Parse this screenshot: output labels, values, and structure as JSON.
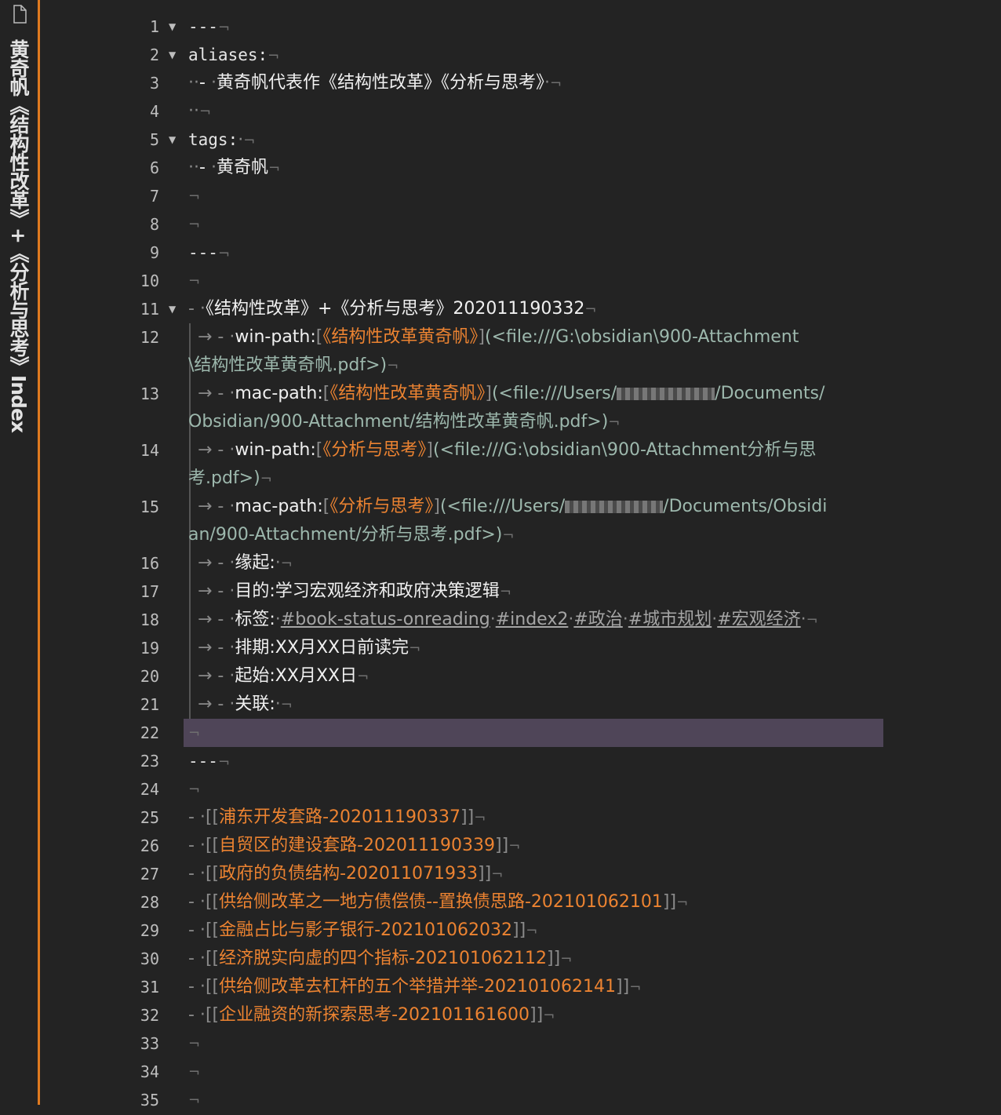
{
  "sidebar": {
    "title": "黄奇帆《结构性改革》+《分析与思考》Index"
  },
  "lines": [
    {
      "n": "1",
      "fold": true,
      "text": "---"
    },
    {
      "n": "2",
      "fold": true,
      "text": "aliases:"
    },
    {
      "n": "3",
      "text": "黄奇帆代表作《结构性改革》《分析与思考》"
    },
    {
      "n": "4"
    },
    {
      "n": "5",
      "fold": true,
      "text": "tags:"
    },
    {
      "n": "6",
      "text": "黄奇帆"
    },
    {
      "n": "7"
    },
    {
      "n": "8"
    },
    {
      "n": "9",
      "text": "---"
    },
    {
      "n": "10"
    },
    {
      "n": "11",
      "fold": true,
      "text": "《结构性改革》+《分析与思考》202011190332"
    },
    {
      "n": "12",
      "label": "win-path:",
      "link": "《结构性改革黄奇帆》",
      "path1": "(<file:///G:\\obsidian\\900-Attachment",
      "path2": "\\结构性改革黄奇帆.pdf>)"
    },
    {
      "n": "13",
      "label": "mac-path:",
      "link": "《结构性改革黄奇帆》",
      "path1": "(<file:///Users/",
      "path1b": "/Documents/",
      "path2": "Obsidian/900-Attachment/结构性改革黄奇帆.pdf>)"
    },
    {
      "n": "14",
      "label": "win-path:",
      "link": "《分析与思考》",
      "path1": "(<file:///G:\\obsidian\\900-Attachment分析与思",
      "path2": "考.pdf>)"
    },
    {
      "n": "15",
      "label": "mac-path:",
      "link": "《分析与思考》",
      "path1": "(<file:///Users/",
      "path1b": "/Documents/Obsidi",
      "path2": "an/900-Attachment/分析与思考.pdf>)"
    },
    {
      "n": "16",
      "label": "缘起:"
    },
    {
      "n": "17",
      "label": "目的:",
      "value": "学习宏观经济和政府决策逻辑"
    },
    {
      "n": "18",
      "label": "标签:",
      "tags": [
        "#book-status-onreading",
        "#index2",
        "#政治",
        "#城市规划",
        "#宏观经济"
      ]
    },
    {
      "n": "19",
      "label": "排期:",
      "value": "XX月XX日前读完"
    },
    {
      "n": "20",
      "label": "起始:",
      "value": "XX月XX日"
    },
    {
      "n": "21",
      "label": "关联:"
    },
    {
      "n": "22"
    },
    {
      "n": "23",
      "text": "---"
    },
    {
      "n": "24"
    },
    {
      "n": "25",
      "wikilink": "浦东开发套路-202011190337"
    },
    {
      "n": "26",
      "wikilink": "自贸区的建设套路-202011190339"
    },
    {
      "n": "27",
      "wikilink": "政府的负债结构-202011071933"
    },
    {
      "n": "28",
      "wikilink": "供给侧改革之一地方债偿债--置换债思路-202101062101"
    },
    {
      "n": "29",
      "wikilink": "金融占比与影子银行-202101062032"
    },
    {
      "n": "30",
      "wikilink": "经济脱实向虚的四个指标-202101062112"
    },
    {
      "n": "31",
      "wikilink": "供给侧改革去杠杆的五个举措并举-202101062141"
    },
    {
      "n": "32",
      "wikilink": "企业融资的新探索思考-202101161600"
    },
    {
      "n": "33"
    },
    {
      "n": "34"
    },
    {
      "n": "35"
    }
  ],
  "colors": {
    "accent": "#e07a1f",
    "link": "#ec8331",
    "path": "#9db8ad",
    "active_line": "#4f4558"
  }
}
